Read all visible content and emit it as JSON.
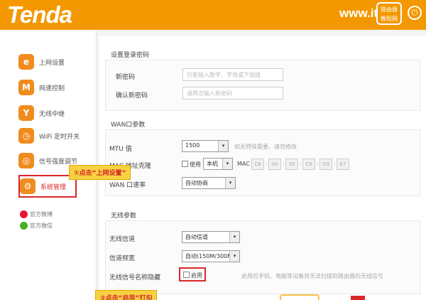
{
  "header": {
    "logo": "Tenda",
    "watermark_site": "www.it",
    "watermark_badge": "路由器 教程网",
    "exit_glyph": "⏻"
  },
  "sidebar": {
    "items": [
      {
        "label": "上网设置",
        "icon": "e"
      },
      {
        "label": "网速控制",
        "icon": "M"
      },
      {
        "label": "无线中继",
        "icon": "Y"
      },
      {
        "label": "WiFi 定时开关",
        "icon": "◷"
      },
      {
        "label": "信号强度调节",
        "icon": "◎"
      },
      {
        "label": "系统管理",
        "icon": "⚙"
      }
    ],
    "social": [
      {
        "label": "官方微博",
        "color": "#e6162d"
      },
      {
        "label": "官方微信",
        "color": "#46b11f"
      }
    ]
  },
  "login_password": {
    "title": "设置登录密码",
    "new_password_label": "新密码",
    "new_password_placeholder": "只能输入数字、字母或下划线",
    "confirm_label": "确认新密码",
    "confirm_placeholder": "请再次输入新密码"
  },
  "wan": {
    "title": "WAN口参数",
    "mtu_label": "MTU 值",
    "mtu_value": "1500",
    "mtu_hint": "如无特殊需要，请勿修改",
    "mac_label": "MAC 地址克隆",
    "mac_use_label": "使用",
    "mac_source": "本机",
    "mac_prefix": "MAC",
    "mac_segments": [
      "C8",
      "3A",
      "35",
      "C8",
      "D9",
      "E7"
    ],
    "rate_label": "WAN 口速率",
    "rate_value": "自动协商"
  },
  "wireless": {
    "title": "无线参数",
    "channel_label": "无线信道",
    "channel_value": "自动信道",
    "bandwidth_label": "信道频宽",
    "bandwidth_value": "自动(150M/300M)",
    "hide_ssid_label": "无线信号名称隐藏",
    "hide_ssid_option": "启用",
    "hide_ssid_hint": "启用后手机、电脑等设备将无法扫描到路由器的无线信号"
  },
  "callouts": {
    "step1": "①点击“上网设置”",
    "step2": "②点击“启用”打勾"
  },
  "colors": {
    "brand": "#f39800",
    "highlight": "#d9262a",
    "callout_bg": "#f6d243"
  }
}
